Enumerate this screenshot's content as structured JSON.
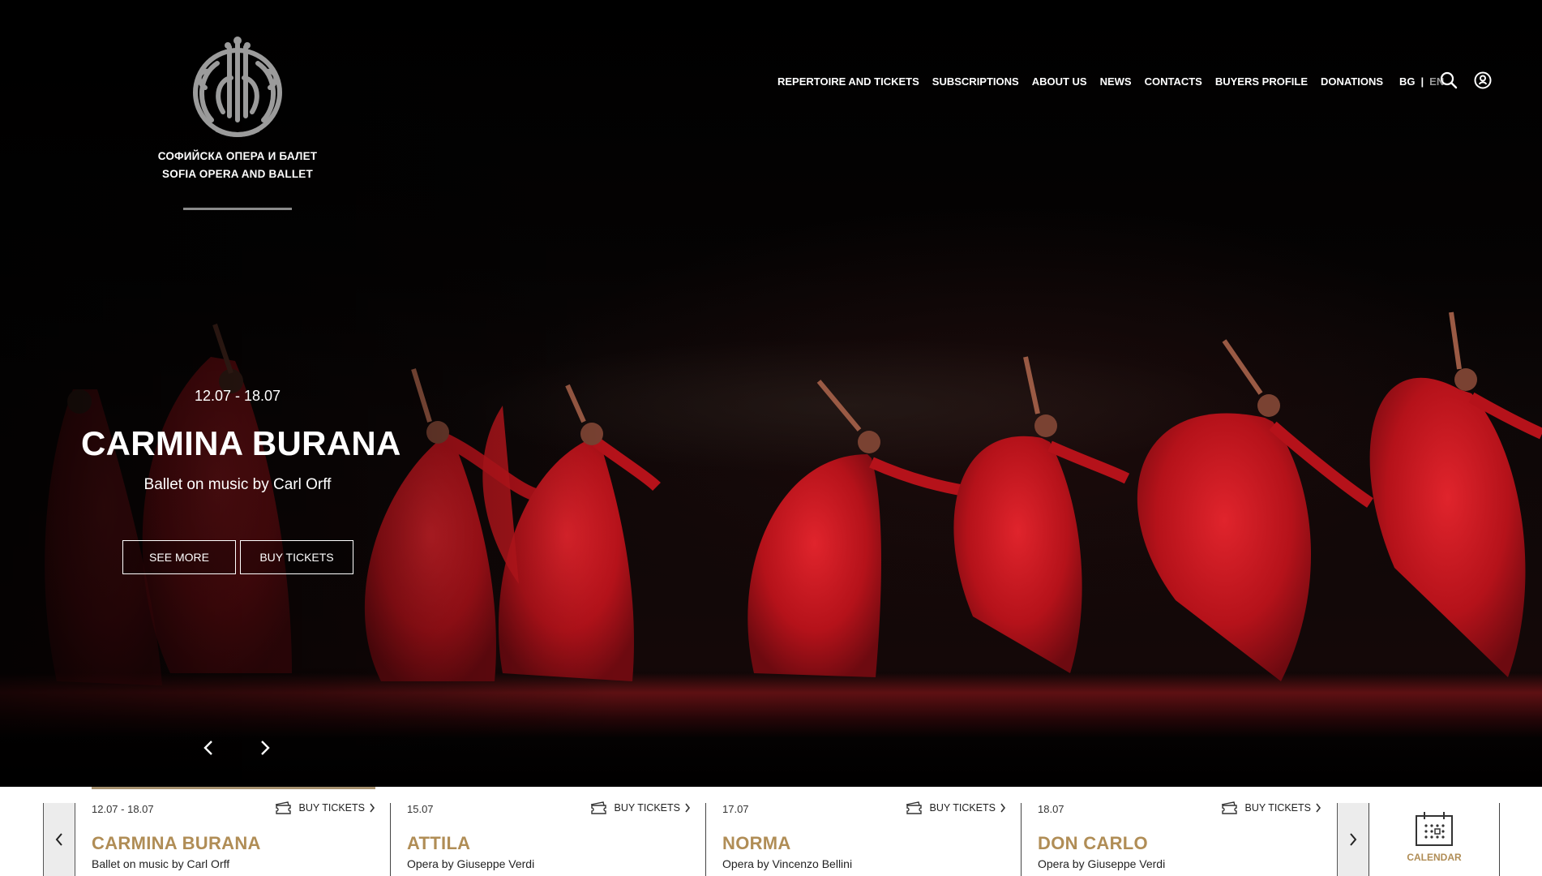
{
  "header": {
    "logo_line1": "СОФИЙСКА ОПЕРА И БАЛЕТ",
    "logo_line2": "SOFIA OPERA AND BALLET",
    "nav": [
      {
        "label": "REPERTOIRE AND TICKETS"
      },
      {
        "label": "SUBSCRIPTIONS"
      },
      {
        "label": "ABOUT US"
      },
      {
        "label": "NEWS"
      },
      {
        "label": "CONTACTS"
      },
      {
        "label": "BUYERS PROFILE"
      },
      {
        "label": "DONATIONS"
      }
    ],
    "lang": {
      "bg": "BG",
      "separator": "|",
      "en": "EN",
      "active": "EN"
    },
    "icons": [
      "search-icon",
      "user-icon"
    ]
  },
  "hero": {
    "date": "12.07 - 18.07",
    "title": "CARMINA BURANA",
    "subtitle": "Ballet on music by Carl Orff",
    "see_more": "SEE MORE",
    "buy_tickets": "BUY TICKETS",
    "icons": [
      "chevron-left-icon",
      "chevron-right-icon"
    ]
  },
  "events": [
    {
      "date": "12.07 - 18.07",
      "buy": "BUY TICKETS",
      "title": "CARMINA BURANA",
      "subtitle": "Ballet on music by Carl Orff",
      "active": true
    },
    {
      "date": "15.07",
      "buy": "BUY TICKETS",
      "title": "ATTILA",
      "subtitle": "Opera by Giuseppe Verdi",
      "active": false
    },
    {
      "date": "17.07",
      "buy": "BUY TICKETS",
      "title": "NORMA",
      "subtitle": "Opera by Vincenzo Bellini",
      "active": false
    },
    {
      "date": "18.07",
      "buy": "BUY TICKETS",
      "title": "DON CARLO",
      "subtitle": "Opera by Giuseppe Verdi",
      "active": false
    }
  ],
  "calendar": {
    "label": "CALENDAR"
  },
  "colors": {
    "accent": "#b08d56",
    "active_bar": "#a79270",
    "dress_red": "#c0141c",
    "background": "#000000"
  }
}
